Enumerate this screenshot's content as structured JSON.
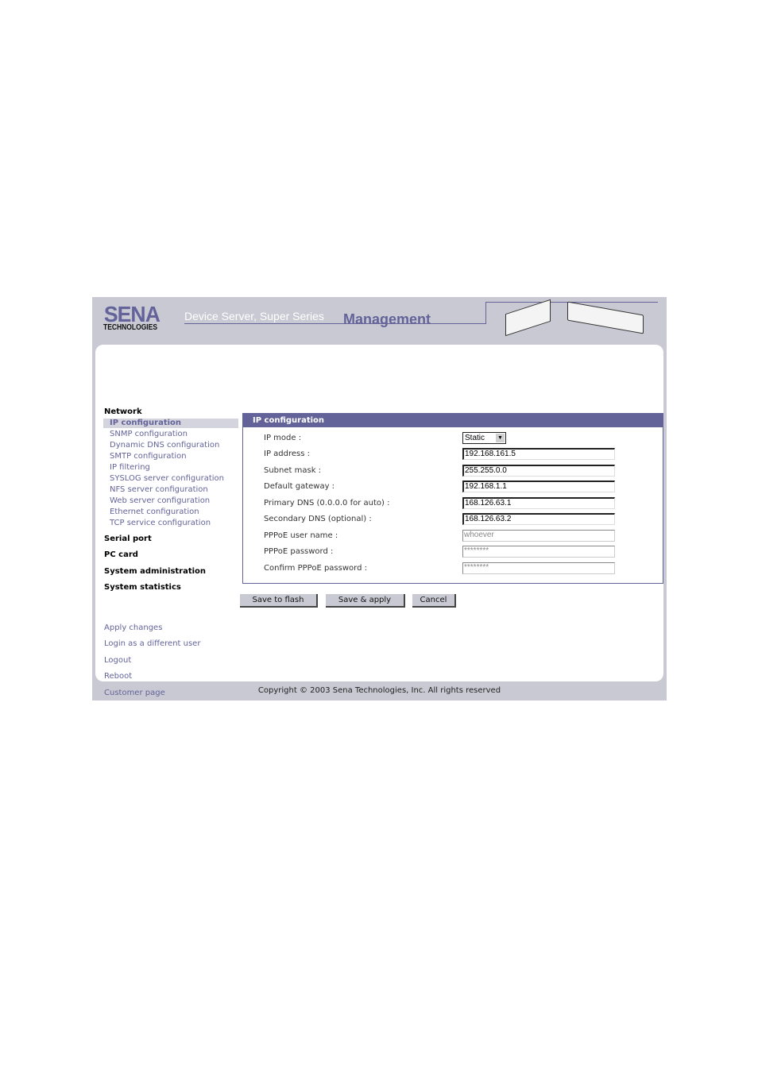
{
  "header": {
    "logo_main": "SENA",
    "logo_sub": "TECHNOLOGIES",
    "subtitle": "Device Server, Super Series",
    "title": "Management"
  },
  "sidebar": {
    "network": "Network",
    "network_items": [
      "IP configuration",
      "SNMP configuration",
      "Dynamic DNS configuration",
      "SMTP configuration",
      "IP filtering",
      "SYSLOG server configuration",
      "NFS server configuration",
      "Web server configuration",
      "Ethernet configuration",
      "TCP service configuration"
    ],
    "sections": [
      "Serial port",
      "PC card",
      "System administration",
      "System statistics"
    ],
    "links": [
      "Apply changes",
      "Login as a different user",
      "Logout",
      "Reboot",
      "Customer page"
    ]
  },
  "panel": {
    "title": "IP configuration",
    "ip_mode": {
      "label": "IP mode :",
      "value": "Static"
    },
    "fields": [
      {
        "label": "IP address :",
        "value": "192.168.161.5"
      },
      {
        "label": "Subnet mask :",
        "value": "255.255.0.0"
      },
      {
        "label": "Default gateway :",
        "value": "192.168.1.1"
      },
      {
        "label": "Primary DNS (0.0.0.0 for auto) :",
        "value": "168.126.63.1"
      },
      {
        "label": "Secondary DNS (optional) :",
        "value": "168.126.63.2"
      },
      {
        "label": "PPPoE user name :",
        "value": "whoever"
      },
      {
        "label": "PPPoE password :",
        "value": "********"
      },
      {
        "label": "Confirm PPPoE password :",
        "value": "********"
      }
    ]
  },
  "buttons": {
    "save_flash": "Save to flash",
    "save_apply": "Save & apply",
    "cancel": "Cancel"
  },
  "footer": "Copyright © 2003 Sena Technologies, Inc. All rights reserved",
  "colors": {
    "accent": "#63639a",
    "frame": "#c9c9d3"
  }
}
